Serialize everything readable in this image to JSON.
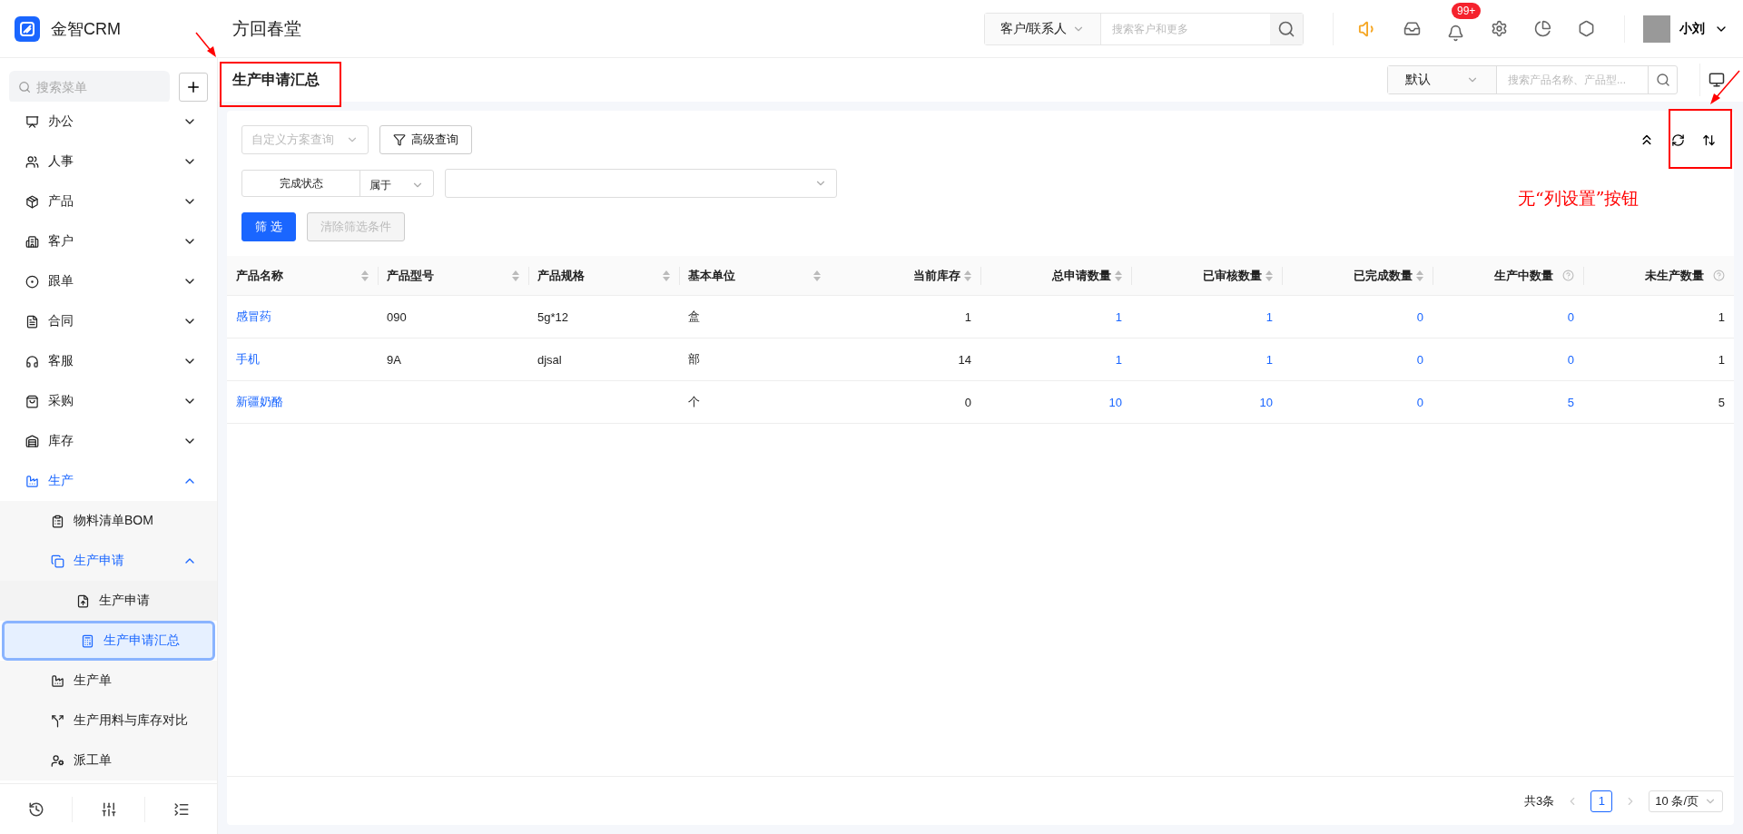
{
  "app": {
    "logo_text": "金智CRM",
    "company": "方回春堂"
  },
  "top_search": {
    "scope": "客户/联系人",
    "placeholder": "搜索客户和更多"
  },
  "notifications": {
    "badge": "99+"
  },
  "user": {
    "name": "小刘"
  },
  "sidebar": {
    "search_placeholder": "搜索菜单",
    "items": [
      {
        "label": "办公",
        "expanded": false,
        "selected": false
      },
      {
        "label": "人事",
        "expanded": false,
        "selected": false
      },
      {
        "label": "产品",
        "expanded": false,
        "selected": false
      },
      {
        "label": "客户",
        "expanded": false,
        "selected": false
      },
      {
        "label": "跟单",
        "expanded": false,
        "selected": false
      },
      {
        "label": "合同",
        "expanded": false,
        "selected": false
      },
      {
        "label": "客服",
        "expanded": false,
        "selected": false
      },
      {
        "label": "采购",
        "expanded": false,
        "selected": false
      },
      {
        "label": "库存",
        "expanded": false,
        "selected": false
      },
      {
        "label": "生产",
        "expanded": true,
        "selected": false,
        "children": [
          {
            "label": "物料清单BOM",
            "selected": false
          },
          {
            "label": "生产申请",
            "expanded": true,
            "selected": false,
            "children": [
              {
                "label": "生产申请",
                "selected": false
              },
              {
                "label": "生产申请汇总",
                "selected": true
              }
            ]
          },
          {
            "label": "生产单",
            "selected": false
          },
          {
            "label": "生产用料与库存对比",
            "selected": false
          },
          {
            "label": "派工单",
            "selected": false
          }
        ]
      }
    ]
  },
  "page": {
    "title": "生产申请汇总",
    "view_select": "默认",
    "search_placeholder": "搜索产品名称、产品型..."
  },
  "filters": {
    "scheme_placeholder": "自定义方案查询",
    "advanced": "高级查询",
    "condition_field": "完成状态",
    "condition_operator": "属于",
    "apply": "筛 选",
    "clear": "清除筛选条件",
    "clear_disabled": true
  },
  "annotation": {
    "note": "无“列设置”按钮"
  },
  "table": {
    "columns": [
      {
        "label": "产品名称",
        "sortable": true,
        "help": false,
        "numeric": false,
        "link": true
      },
      {
        "label": "产品型号",
        "sortable": true,
        "help": false,
        "numeric": false,
        "link": false
      },
      {
        "label": "产品规格",
        "sortable": true,
        "help": false,
        "numeric": false,
        "link": false
      },
      {
        "label": "基本单位",
        "sortable": true,
        "help": false,
        "numeric": false,
        "link": false
      },
      {
        "label": "当前库存",
        "sortable": true,
        "help": false,
        "numeric": true,
        "link": false
      },
      {
        "label": "总申请数量",
        "sortable": true,
        "help": false,
        "numeric": true,
        "link": true
      },
      {
        "label": "已审核数量",
        "sortable": true,
        "help": false,
        "numeric": true,
        "link": true
      },
      {
        "label": "已完成数量",
        "sortable": true,
        "help": false,
        "numeric": true,
        "link": true
      },
      {
        "label": "生产中数量",
        "sortable": false,
        "help": true,
        "numeric": true,
        "link": true
      },
      {
        "label": "未生产数量",
        "sortable": false,
        "help": true,
        "numeric": true,
        "link": false
      }
    ],
    "rows": [
      [
        "感冒药",
        "090",
        "5g*12",
        "盒",
        "1",
        "1",
        "1",
        "0",
        "0",
        "1"
      ],
      [
        "手机",
        "9A",
        "djsal",
        "部",
        "14",
        "1",
        "1",
        "0",
        "0",
        "1"
      ],
      [
        "新疆奶酪",
        "",
        "",
        "个",
        "0",
        "10",
        "10",
        "0",
        "5",
        "5"
      ]
    ]
  },
  "pagination": {
    "total": "共3条",
    "pages": [
      {
        "label": "1",
        "selected": true
      }
    ],
    "page_size": "10 条/页"
  }
}
